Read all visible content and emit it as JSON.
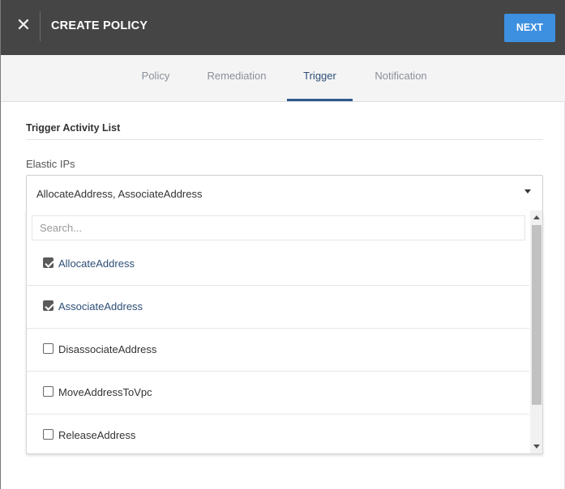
{
  "header": {
    "close_icon": "close-icon",
    "close_glyph": "✕",
    "title": "CREATE POLICY",
    "next_label": "NEXT",
    "accent_color": "#3d8fe0"
  },
  "tabs": [
    {
      "label": "Policy",
      "active": false
    },
    {
      "label": "Remediation",
      "active": false
    },
    {
      "label": "Trigger",
      "active": true
    },
    {
      "label": "Notification",
      "active": false
    }
  ],
  "section": {
    "title": "Trigger Activity List",
    "field_label": "Elastic IPs",
    "selected_value": "AllocateAddress, AssociateAddress"
  },
  "dropdown": {
    "search_placeholder": "Search...",
    "options": [
      {
        "label": "AllocateAddress",
        "checked": true
      },
      {
        "label": "AssociateAddress",
        "checked": true
      },
      {
        "label": "DisassociateAddress",
        "checked": false
      },
      {
        "label": "MoveAddressToVpc",
        "checked": false
      },
      {
        "label": "ReleaseAddress",
        "checked": false
      }
    ]
  }
}
